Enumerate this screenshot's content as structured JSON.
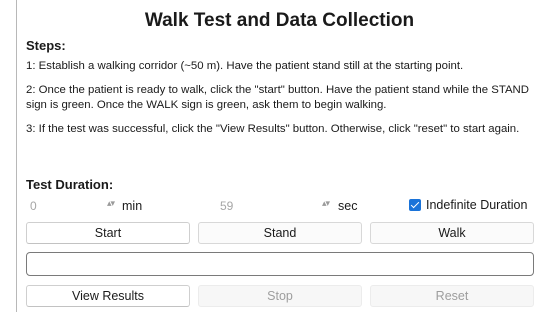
{
  "app": {
    "title": "Walk Test and Data Collection"
  },
  "steps": {
    "heading": "Steps:",
    "items": [
      "1: Establish a walking corridor (~50 m). Have the patient stand still at the starting point.",
      "2: Once the patient is ready to walk, click the \"start\" button. Have the patient stand while the STAND sign is green. Once the WALK sign is green, ask them to begin walking.",
      "3: If the test was successful, click the \"View Results\" button. Otherwise, click \"reset\" to start again."
    ]
  },
  "duration": {
    "heading": "Test Duration:",
    "min_value": "0",
    "min_unit": "min",
    "sec_value": "59",
    "sec_unit": "sec",
    "indefinite_label": "Indefinite Duration",
    "indefinite_checked": true,
    "spinner_icon": "up-down-spinner-icon"
  },
  "buttons": {
    "start": "Start",
    "stand": "Stand",
    "walk": "Walk",
    "view_results": "View Results",
    "stop": "Stop",
    "reset": "Reset"
  },
  "status_field": {
    "value": ""
  },
  "colors": {
    "accent": "#1a73d9",
    "disabled_text": "#9e9e9e"
  }
}
